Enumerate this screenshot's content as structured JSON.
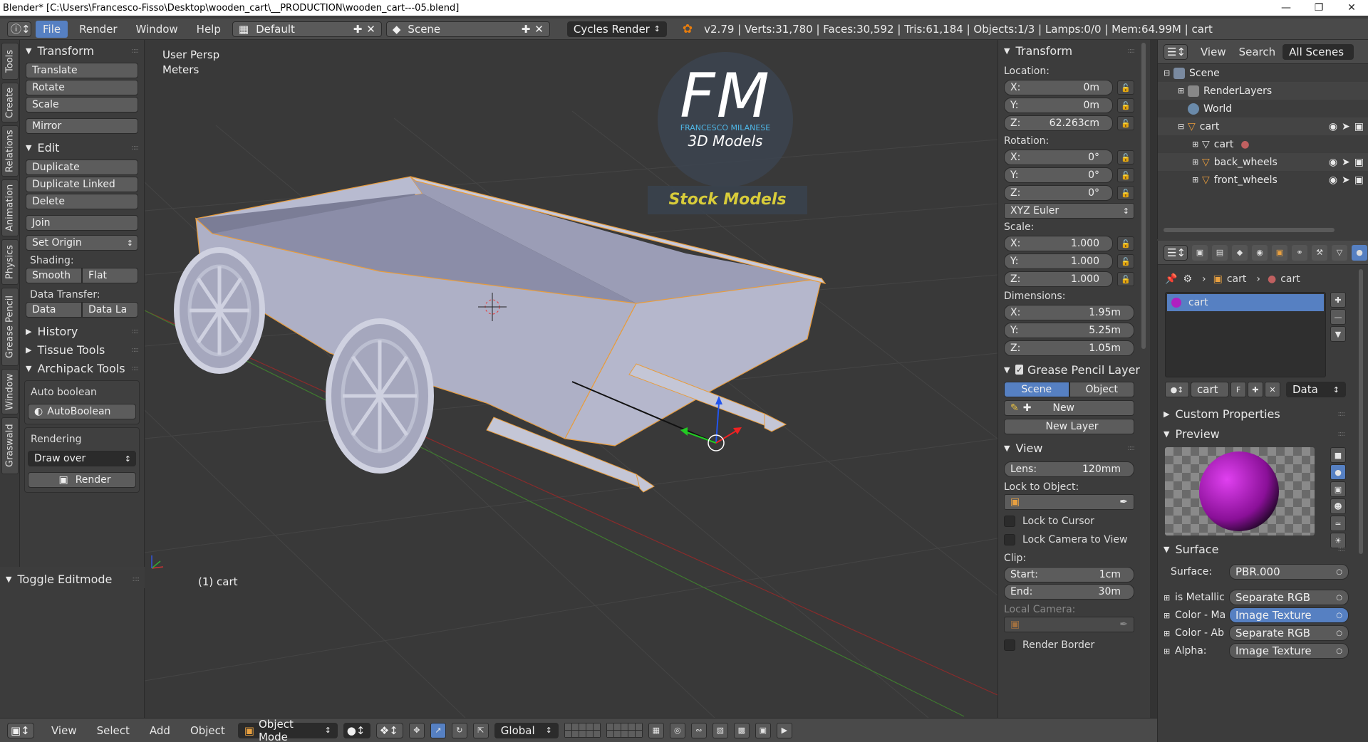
{
  "window": {
    "title": "Blender* [C:\\Users\\Francesco-Fisso\\Desktop\\wooden_cart\\__PRODUCTION\\wooden_cart---05.blend]"
  },
  "info": {
    "menus": [
      "File",
      "Render",
      "Window",
      "Help"
    ],
    "layout": "Default",
    "scene": "Scene",
    "engine": "Cycles Render",
    "stats": "v2.79 | Verts:31,780 | Faces:30,592 | Tris:61,184 | Objects:1/3 | Lamps:0/0 | Mem:64.99M | cart"
  },
  "tabs": [
    "Tools",
    "Create",
    "Relations",
    "Animation",
    "Physics",
    "Grease Pencil",
    "Window",
    "Graswald"
  ],
  "toolshelf": {
    "transform_title": "Transform",
    "translate": "Translate",
    "rotate": "Rotate",
    "scale": "Scale",
    "mirror": "Mirror",
    "edit_title": "Edit",
    "duplicate": "Duplicate",
    "duplicate_linked": "Duplicate Linked",
    "delete": "Delete",
    "join": "Join",
    "set_origin": "Set Origin",
    "shading_label": "Shading:",
    "smooth": "Smooth",
    "flat": "Flat",
    "data_transfer_label": "Data Transfer:",
    "data": "Data",
    "data_la": "Data La",
    "history": "History",
    "tissue": "Tissue Tools",
    "archipack": "Archipack Tools",
    "auto_boolean_label": "Auto boolean",
    "auto_boolean_btn": "AutoBoolean",
    "rendering_label": "Rendering",
    "draw_over": "Draw over",
    "render": "Render",
    "toggle_editmode": "Toggle Editmode"
  },
  "viewport": {
    "view_name": "User Persp",
    "units": "Meters",
    "object_label": "(1) cart",
    "logo_letters": "FM",
    "logo_name": "FRANCESCO MILANESE",
    "logo_sub": "3D Models",
    "logo_badge": "Stock Models"
  },
  "npanel": {
    "transform_title": "Transform",
    "location_label": "Location:",
    "loc": [
      {
        "axis": "X:",
        "value": "0m"
      },
      {
        "axis": "Y:",
        "value": "0m"
      },
      {
        "axis": "Z:",
        "value": "62.263cm"
      }
    ],
    "rotation_label": "Rotation:",
    "rot": [
      {
        "axis": "X:",
        "value": "0°"
      },
      {
        "axis": "Y:",
        "value": "0°"
      },
      {
        "axis": "Z:",
        "value": "0°"
      }
    ],
    "rotation_mode": "XYZ Euler",
    "scale_label": "Scale:",
    "scale": [
      {
        "axis": "X:",
        "value": "1.000"
      },
      {
        "axis": "Y:",
        "value": "1.000"
      },
      {
        "axis": "Z:",
        "value": "1.000"
      }
    ],
    "dimensions_label": "Dimensions:",
    "dim": [
      {
        "axis": "X:",
        "value": "1.95m"
      },
      {
        "axis": "Y:",
        "value": "5.25m"
      },
      {
        "axis": "Z:",
        "value": "1.05m"
      }
    ],
    "gp_title": "Grease Pencil Layer",
    "gp_scene": "Scene",
    "gp_object": "Object",
    "gp_new": "New",
    "gp_new_layer": "New Layer",
    "view_title": "View",
    "lens_label": "Lens:",
    "lens_value": "120mm",
    "lock_object_label": "Lock to Object:",
    "lock_cursor": "Lock to Cursor",
    "lock_camera": "Lock Camera to View",
    "clip_label": "Clip:",
    "clip_start_label": "Start:",
    "clip_start": "1cm",
    "clip_end_label": "End:",
    "clip_end": "30m",
    "local_camera_label": "Local Camera:",
    "render_border": "Render Border"
  },
  "outliner": {
    "view": "View",
    "search": "Search",
    "filter": "All Scenes",
    "items": [
      {
        "label": "Scene",
        "indent": 0
      },
      {
        "label": "RenderLayers",
        "indent": 1
      },
      {
        "label": "World",
        "indent": 1
      },
      {
        "label": "cart",
        "indent": 1
      },
      {
        "label": "cart",
        "indent": 2
      },
      {
        "label": "back_wheels",
        "indent": 2
      },
      {
        "label": "front_wheels",
        "indent": 2
      }
    ]
  },
  "properties": {
    "crumb_object": "cart",
    "crumb_material": "cart",
    "slot_name": "cart",
    "material_field": "cart",
    "material_f": "F",
    "link_mode": "Data",
    "custom_props": "Custom Properties",
    "preview_title": "Preview",
    "surface_title": "Surface",
    "surface_label": "Surface:",
    "surface_value": "PBR.000",
    "inputs": [
      {
        "label": "is Metallic",
        "value": "Separate RGB"
      },
      {
        "label": "Color - Ma",
        "value": "Image Texture"
      },
      {
        "label": "Color - Ab",
        "value": "Separate RGB"
      },
      {
        "label": "Alpha:",
        "value": "Image Texture"
      }
    ]
  },
  "bottombar": {
    "view": "View",
    "select": "Select",
    "add": "Add",
    "object": "Object",
    "mode": "Object Mode",
    "orientation": "Global"
  },
  "colors": {
    "selection_blue": "#5680c2",
    "material_magenta": "#b020c0",
    "logo_badge_yellow": "#d8cc3a",
    "outline_orange": "#e89c3c"
  }
}
